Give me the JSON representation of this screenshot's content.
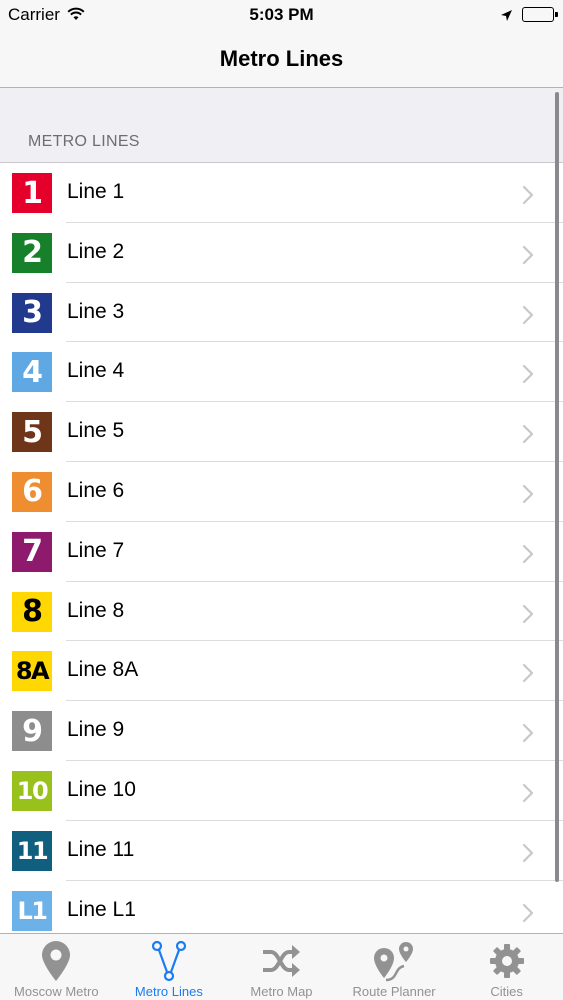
{
  "status_bar": {
    "carrier": "Carrier",
    "time": "5:03 PM"
  },
  "nav": {
    "title": "Metro Lines"
  },
  "section": {
    "header": "METRO LINES"
  },
  "lines": [
    {
      "badge": "1",
      "label": "Line 1",
      "color": "#e4002b",
      "text_color": "#ffffff"
    },
    {
      "badge": "2",
      "label": "Line 2",
      "color": "#16802a",
      "text_color": "#ffffff"
    },
    {
      "badge": "3",
      "label": "Line 3",
      "color": "#223a8e",
      "text_color": "#ffffff"
    },
    {
      "badge": "4",
      "label": "Line 4",
      "color": "#5fa8e4",
      "text_color": "#ffffff"
    },
    {
      "badge": "5",
      "label": "Line 5",
      "color": "#6f3518",
      "text_color": "#ffffff"
    },
    {
      "badge": "6",
      "label": "Line 6",
      "color": "#ef8d31",
      "text_color": "#ffffff"
    },
    {
      "badge": "7",
      "label": "Line 7",
      "color": "#8e1a6e",
      "text_color": "#ffffff"
    },
    {
      "badge": "8",
      "label": "Line 8",
      "color": "#ffd702",
      "text_color": "#000000"
    },
    {
      "badge": "8A",
      "label": "Line 8A",
      "color": "#ffd702",
      "text_color": "#000000"
    },
    {
      "badge": "9",
      "label": "Line 9",
      "color": "#8d8d8d",
      "text_color": "#ffffff"
    },
    {
      "badge": "10",
      "label": "Line 10",
      "color": "#99c11c",
      "text_color": "#ffffff"
    },
    {
      "badge": "11",
      "label": "Line 11",
      "color": "#105f7e",
      "text_color": "#ffffff"
    },
    {
      "badge": "L1",
      "label": "Line L1",
      "color": "#6cb2e8",
      "text_color": "#ffffff"
    }
  ],
  "tabs": [
    {
      "label": "Moscow Metro",
      "icon": "map-pin-icon",
      "active": false
    },
    {
      "label": "Metro Lines",
      "icon": "branch-lines-icon",
      "active": true
    },
    {
      "label": "Metro Map",
      "icon": "shuffle-icon",
      "active": false
    },
    {
      "label": "Route Planner",
      "icon": "route-planner-icon",
      "active": false
    },
    {
      "label": "Cities",
      "icon": "gear-icon",
      "active": false
    }
  ],
  "colors": {
    "accent": "#1a7cf3",
    "tab_inactive": "#929292"
  }
}
